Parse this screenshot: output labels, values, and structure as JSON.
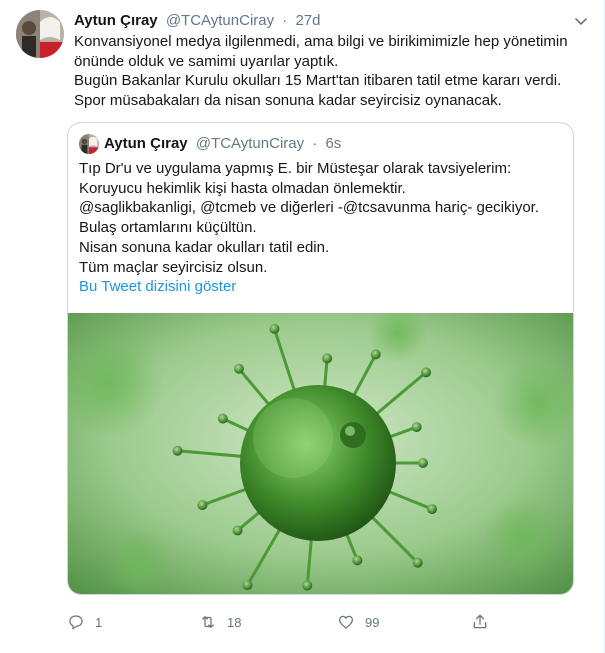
{
  "tweet": {
    "author_name": "Aytun Çıray",
    "handle": "@TCAytunCiray",
    "separator": "·",
    "time": "27d",
    "lines": [
      "Konvansiyonel medya ilgilenmedi, ama bilgi ve birikimimizle hep yönetimin",
      "önünde olduk ve samimi uyarılar yaptık.",
      "Bugün Bakanlar Kurulu okulları 15 Mart'tan itibaren tatil etme kararı verdi.",
      "Spor müsabakaları da nisan sonuna kadar seyircisiz oynanacak."
    ]
  },
  "quoted": {
    "author_name": "Aytun Çıray",
    "handle": "@TCAytunCiray",
    "separator": "·",
    "time": "6s",
    "lines": [
      "Tıp Dr'u ve uygulama yapmış E. bir Müsteşar olarak tavsiyelerim:",
      "Koruyucu hekimlik kişi hasta olmadan önlemektir.",
      "@saglikbakanligi, @tcmeb ve diğerleri -@tcsavunma hariç- gecikiyor.",
      "Bulaş ortamlarını küçültün.",
      "Nisan sonuna kadar okulları tatil edin.",
      "Tüm maçlar seyircisiz olsun."
    ],
    "thread_link": "Bu Tweet dizisini göster"
  },
  "actions": {
    "reply_count": "1",
    "retweet_count": "18",
    "like_count": "99"
  },
  "icons": {
    "caret": "chevron-down-icon",
    "reply": "reply-icon",
    "retweet": "retweet-icon",
    "like": "heart-icon",
    "share": "share-icon"
  },
  "colors": {
    "link": "#1b95e0",
    "muted": "#657786",
    "border": "#ccd6dd",
    "virus_green": "#3f8a2a"
  }
}
